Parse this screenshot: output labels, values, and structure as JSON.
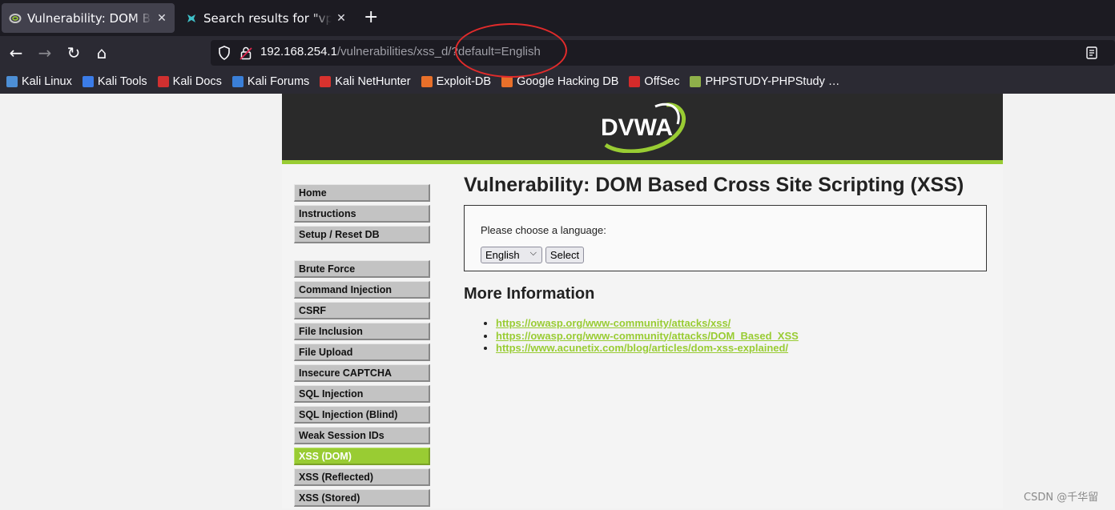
{
  "browser": {
    "tabs": [
      {
        "title": "Vulnerability: DOM Based Cross Site Scripting (XSS)",
        "close": "✕"
      },
      {
        "title": "Search results for \"vpn\" – Kali Tools",
        "close": "✕"
      }
    ],
    "new_tab": "+",
    "nav": {
      "back": "←",
      "forward": "→",
      "reload": "↻",
      "home": "⌂"
    },
    "url_host": "192.168.254.1",
    "url_path": "/vulnerabilities/xss_d/?default=English",
    "bookmarks": [
      {
        "label": "Kali Linux",
        "color": "#4d8fd6"
      },
      {
        "label": "Kali Tools",
        "color": "#3b7ce8"
      },
      {
        "label": "Kali Docs",
        "color": "#d03030"
      },
      {
        "label": "Kali Forums",
        "color": "#3a7fd8"
      },
      {
        "label": "Kali NetHunter",
        "color": "#d8322e"
      },
      {
        "label": "Exploit-DB",
        "color": "#e8702a"
      },
      {
        "label": "Google Hacking DB",
        "color": "#e8702a"
      },
      {
        "label": "OffSec",
        "color": "#d52a2a"
      },
      {
        "label": "PHPSTUDY-PHPStudy …",
        "color": "#8fb04a"
      }
    ]
  },
  "dvwa": {
    "logo": "DVWA",
    "menu_top": [
      "Home",
      "Instructions",
      "Setup / Reset DB"
    ],
    "menu_vulns": [
      "Brute Force",
      "Command Injection",
      "CSRF",
      "File Inclusion",
      "File Upload",
      "Insecure CAPTCHA",
      "SQL Injection",
      "SQL Injection (Blind)",
      "Weak Session IDs",
      "XSS (DOM)",
      "XSS (Reflected)",
      "XSS (Stored)"
    ],
    "selected_menu": "XSS (DOM)",
    "title": "Vulnerability: DOM Based Cross Site Scripting (XSS)",
    "prompt": "Please choose a language:",
    "select_value": "English",
    "select_button": "Select",
    "more_info_heading": "More Information",
    "links": [
      "https://owasp.org/www-community/attacks/xss/",
      "https://owasp.org/www-community/attacks/DOM_Based_XSS",
      "https://www.acunetix.com/blog/articles/dom-xss-explained/"
    ]
  },
  "watermark": "CSDN @千华留",
  "colors": {
    "accent": "#99cc33",
    "header": "#2a2a2a",
    "annotation": "#e12b2b"
  }
}
